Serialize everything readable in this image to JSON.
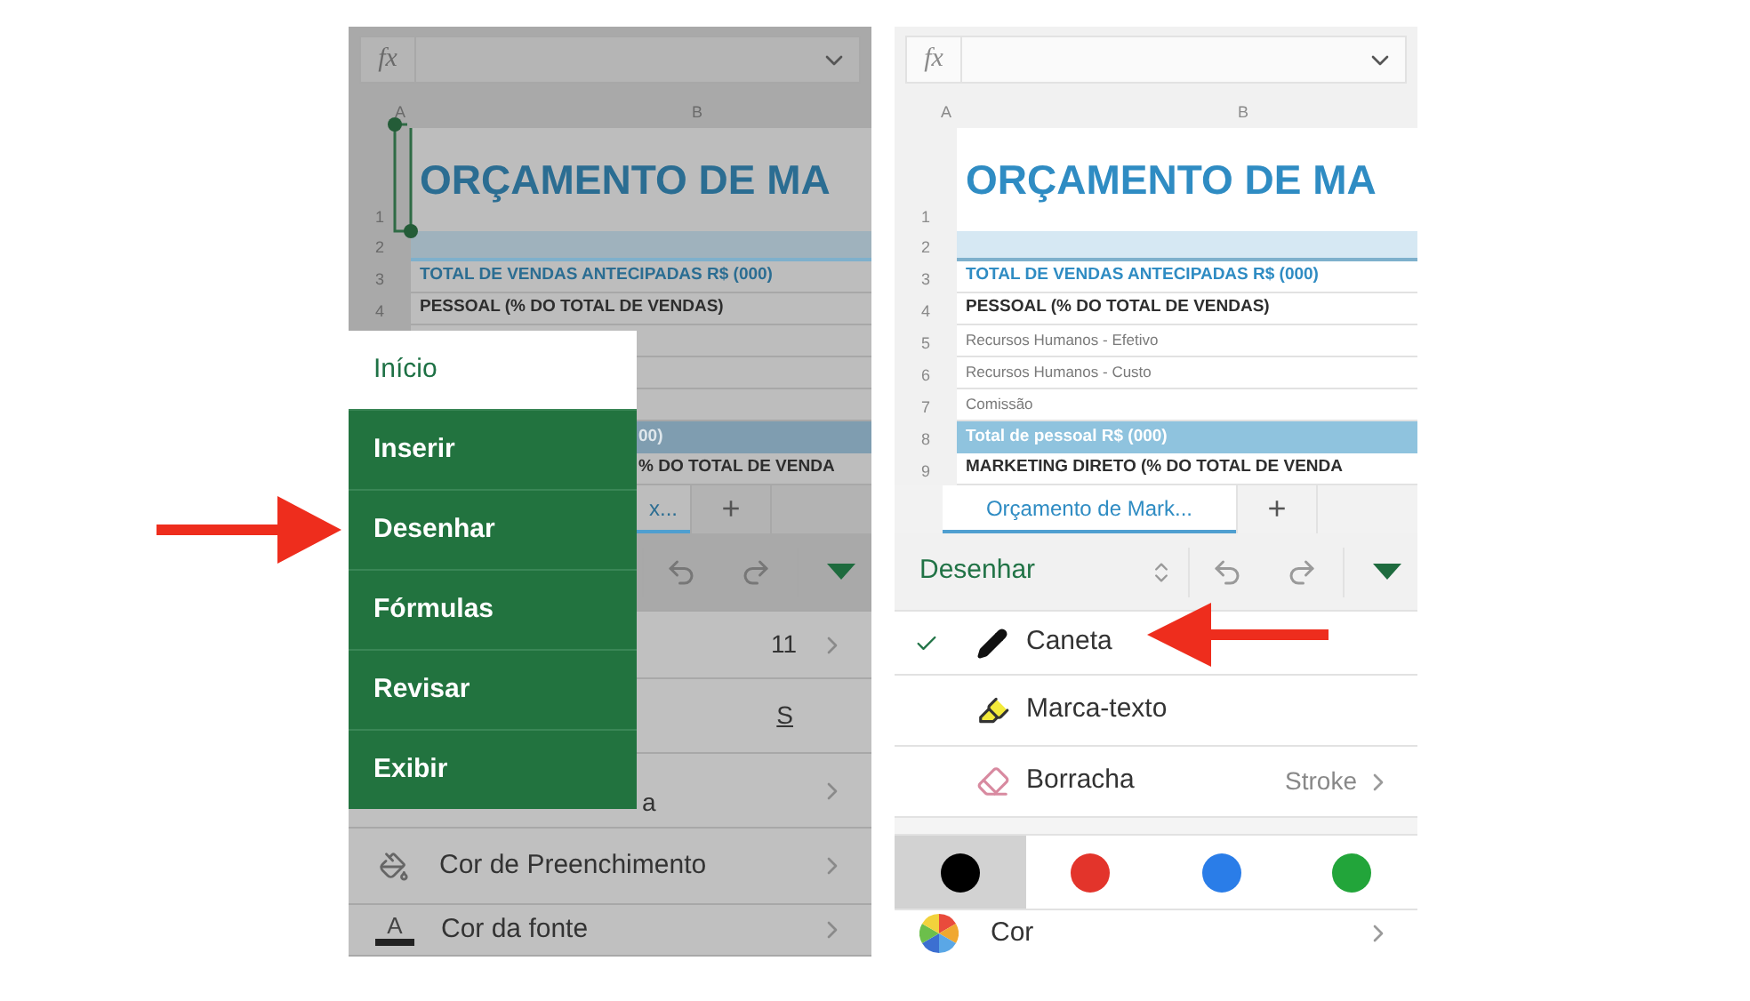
{
  "left_screen": {
    "formula_label": "fx",
    "column_headers": [
      "A",
      "B"
    ],
    "rows": [
      {
        "number": "1",
        "kind": "title",
        "text": "ORÇAMENTO DE MA"
      },
      {
        "number": "2",
        "kind": "band"
      },
      {
        "number": "3",
        "kind": "heading",
        "text": "TOTAL DE VENDAS ANTECIPADAS R$ (000)"
      },
      {
        "number": "4",
        "kind": "bold",
        "text": "PESSOAL (% DO TOTAL DE VENDAS)"
      },
      {
        "kind": "plain"
      },
      {
        "kind": "plain"
      },
      {
        "kind": "plain"
      },
      {
        "kind": "total",
        "text": "00)"
      },
      {
        "kind": "bold",
        "text": "% DO TOTAL DE VENDA"
      }
    ],
    "sheet_tab": {
      "label": "x...",
      "selected": true
    },
    "add_sheet": "+",
    "list": [
      {
        "kind": "value",
        "value": "11",
        "chevron": true
      },
      {
        "kind": "underline",
        "value": "S"
      },
      {
        "kind": "label",
        "label": "a",
        "chevron": true
      },
      {
        "kind": "fill",
        "label": "Cor de Preenchimento",
        "chevron": true
      },
      {
        "kind": "font",
        "icon_text": "A",
        "label": "Cor da fonte",
        "chevron": true
      }
    ],
    "menu": [
      {
        "label": "Início",
        "selected": true
      },
      {
        "label": "Inserir",
        "selected": false
      },
      {
        "label": "Desenhar",
        "selected": false
      },
      {
        "label": "Fórmulas",
        "selected": false
      },
      {
        "label": "Revisar",
        "selected": false
      },
      {
        "label": "Exibir",
        "selected": false
      }
    ]
  },
  "right_screen": {
    "formula_label": "fx",
    "column_headers": [
      "A",
      "B"
    ],
    "rows": [
      {
        "number": "1",
        "kind": "title",
        "text": "ORÇAMENTO DE MA"
      },
      {
        "number": "2",
        "kind": "band"
      },
      {
        "number": "3",
        "kind": "heading",
        "text": "TOTAL DE VENDAS ANTECIPADAS R$ (000)"
      },
      {
        "number": "4",
        "kind": "bold",
        "text": "PESSOAL (% DO TOTAL DE VENDAS)"
      },
      {
        "number": "5",
        "kind": "plain",
        "text": "Recursos  Humanos  - Efetivo"
      },
      {
        "number": "6",
        "kind": "plain",
        "text": "Recursos  Humanos  - Custo"
      },
      {
        "number": "7",
        "kind": "plain",
        "text": "Comissão"
      },
      {
        "number": "8",
        "kind": "total",
        "text": "Total de pessoal R$ (000)"
      },
      {
        "number": "9",
        "kind": "bold",
        "text": "MARKETING DIRETO (% DO TOTAL DE VENDA"
      }
    ],
    "sheet_tab": {
      "label": "Orçamento de Mark...",
      "selected": true
    },
    "add_sheet": "+",
    "toolbar_label": "Desenhar",
    "tools": [
      {
        "kind": "pen",
        "label": "Caneta",
        "checked": true
      },
      {
        "kind": "highlighter",
        "label": "Marca-texto",
        "checked": false
      },
      {
        "kind": "eraser",
        "label": "Borracha",
        "checked": false,
        "value": "Stroke"
      }
    ],
    "swatches": [
      {
        "color": "#000000",
        "selected": true
      },
      {
        "color": "#e3342b",
        "selected": false
      },
      {
        "color": "#2a7de8",
        "selected": false
      },
      {
        "color": "#22a53a",
        "selected": false
      }
    ],
    "color_row": {
      "label": "Cor"
    }
  }
}
